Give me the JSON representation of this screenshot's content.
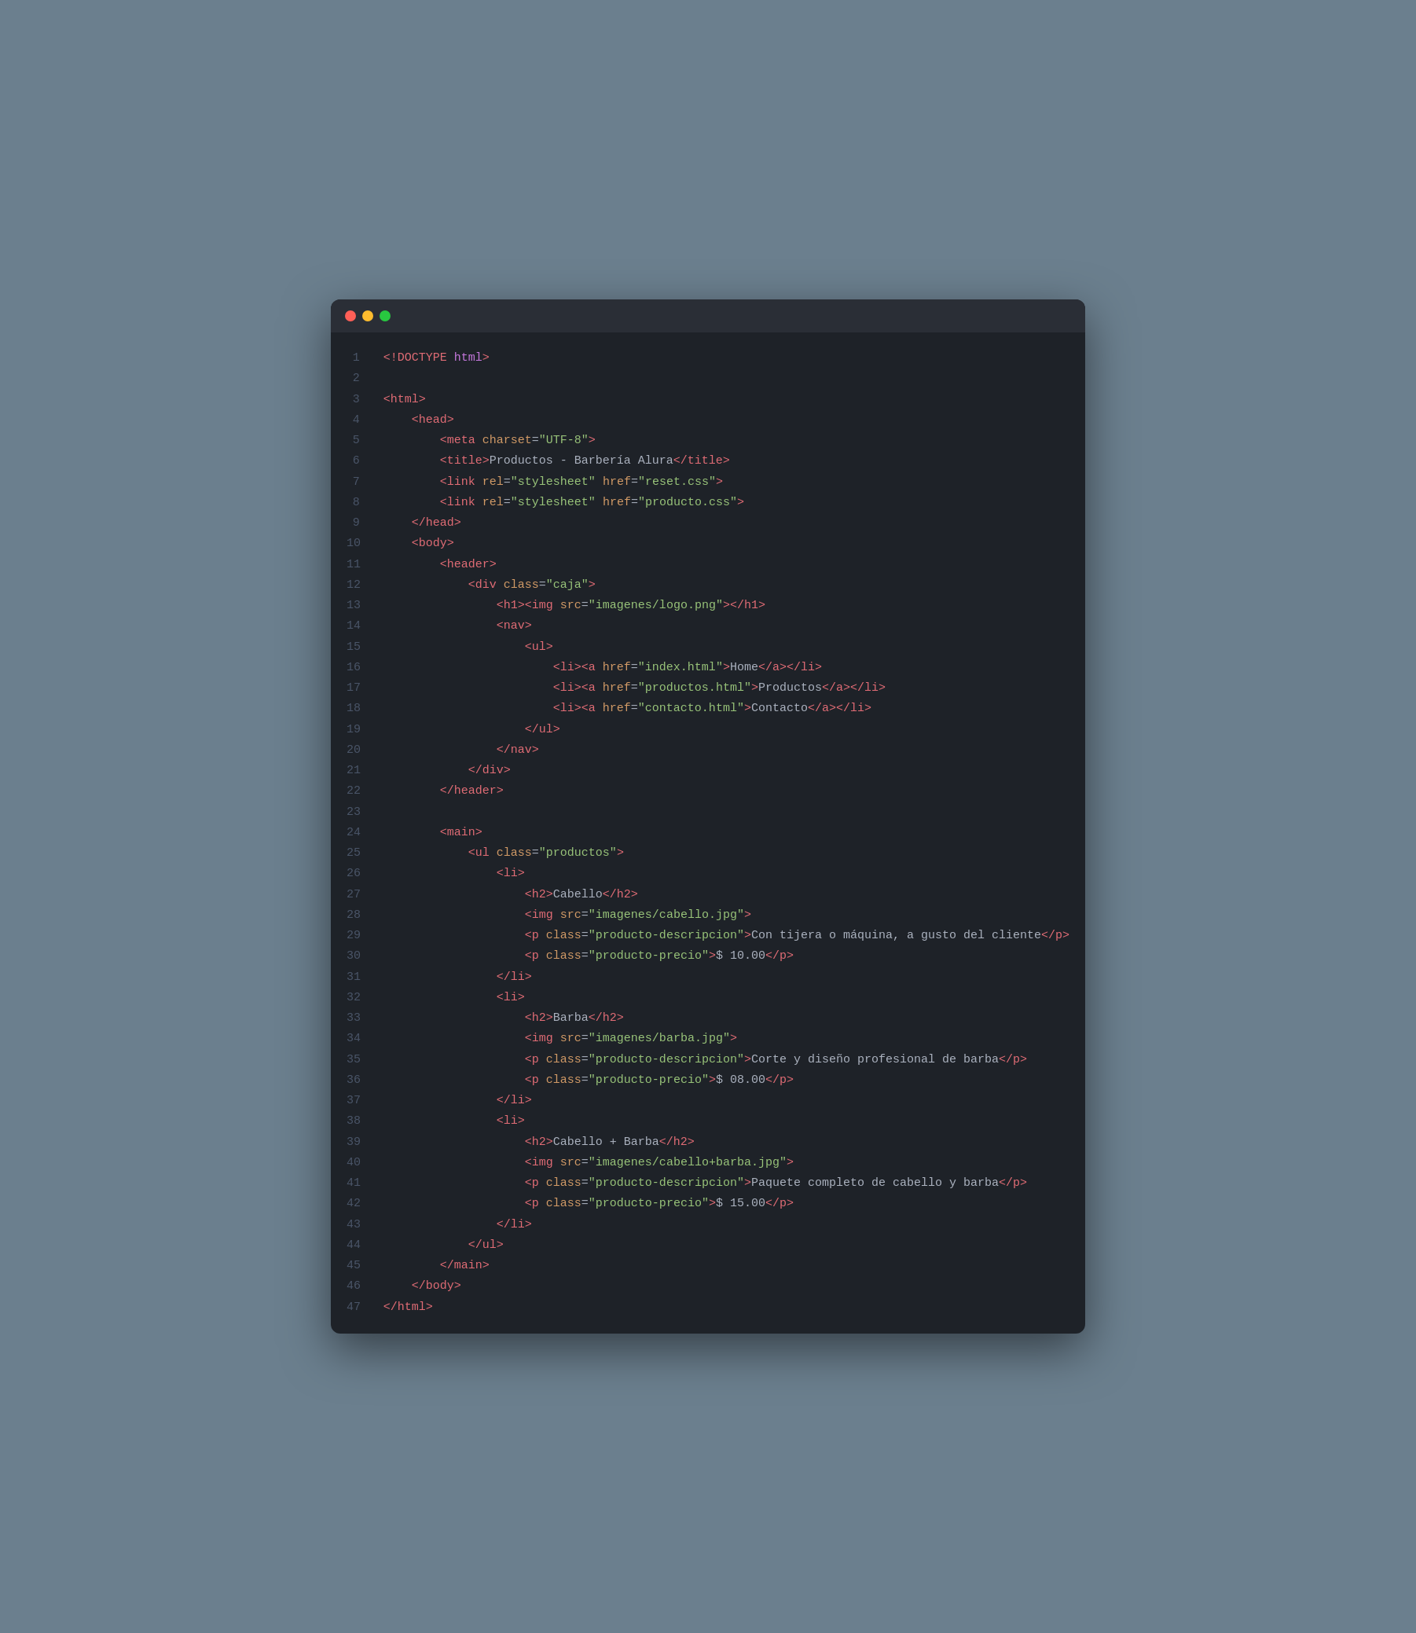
{
  "window": {
    "close_label": "",
    "minimize_label": "",
    "maximize_label": ""
  },
  "lines": [
    {
      "num": 1,
      "tokens": [
        {
          "t": "<!DOCTYPE ",
          "c": "c-tag"
        },
        {
          "t": "html",
          "c": "c-keyword"
        },
        {
          "t": ">",
          "c": "c-tag"
        }
      ]
    },
    {
      "num": 2,
      "tokens": []
    },
    {
      "num": 3,
      "tokens": [
        {
          "t": "<html>",
          "c": "c-tag"
        }
      ]
    },
    {
      "num": 4,
      "tokens": [
        {
          "t": "    <head>",
          "c": "c-tag"
        }
      ]
    },
    {
      "num": 5,
      "tokens": [
        {
          "t": "        <meta ",
          "c": "c-tag"
        },
        {
          "t": "charset",
          "c": "c-attr"
        },
        {
          "t": "=",
          "c": "c-white"
        },
        {
          "t": "\"UTF-8\"",
          "c": "c-string"
        },
        {
          "t": ">",
          "c": "c-tag"
        }
      ]
    },
    {
      "num": 6,
      "tokens": [
        {
          "t": "        <title>",
          "c": "c-tag"
        },
        {
          "t": "Productos - Barbería Alura",
          "c": "c-text"
        },
        {
          "t": "</title>",
          "c": "c-tag"
        }
      ]
    },
    {
      "num": 7,
      "tokens": [
        {
          "t": "        <link ",
          "c": "c-tag"
        },
        {
          "t": "rel",
          "c": "c-attr"
        },
        {
          "t": "=",
          "c": "c-white"
        },
        {
          "t": "\"stylesheet\"",
          "c": "c-string"
        },
        {
          "t": " ",
          "c": "c-white"
        },
        {
          "t": "href",
          "c": "c-attr"
        },
        {
          "t": "=",
          "c": "c-white"
        },
        {
          "t": "\"reset.css\"",
          "c": "c-string"
        },
        {
          "t": ">",
          "c": "c-tag"
        }
      ]
    },
    {
      "num": 8,
      "tokens": [
        {
          "t": "        <link ",
          "c": "c-tag"
        },
        {
          "t": "rel",
          "c": "c-attr"
        },
        {
          "t": "=",
          "c": "c-white"
        },
        {
          "t": "\"stylesheet\"",
          "c": "c-string"
        },
        {
          "t": " ",
          "c": "c-white"
        },
        {
          "t": "href",
          "c": "c-attr"
        },
        {
          "t": "=",
          "c": "c-white"
        },
        {
          "t": "\"producto.css\"",
          "c": "c-string"
        },
        {
          "t": ">",
          "c": "c-tag"
        }
      ]
    },
    {
      "num": 9,
      "tokens": [
        {
          "t": "    </head>",
          "c": "c-tag"
        }
      ]
    },
    {
      "num": 10,
      "tokens": [
        {
          "t": "    <body>",
          "c": "c-tag"
        }
      ]
    },
    {
      "num": 11,
      "tokens": [
        {
          "t": "        <header>",
          "c": "c-tag"
        }
      ]
    },
    {
      "num": 12,
      "tokens": [
        {
          "t": "            <div ",
          "c": "c-tag"
        },
        {
          "t": "class",
          "c": "c-attr"
        },
        {
          "t": "=",
          "c": "c-white"
        },
        {
          "t": "\"caja\"",
          "c": "c-string"
        },
        {
          "t": ">",
          "c": "c-tag"
        }
      ]
    },
    {
      "num": 13,
      "tokens": [
        {
          "t": "                <h1><img ",
          "c": "c-tag"
        },
        {
          "t": "src",
          "c": "c-attr"
        },
        {
          "t": "=",
          "c": "c-white"
        },
        {
          "t": "\"imagenes/logo.png\"",
          "c": "c-string"
        },
        {
          "t": "></h1>",
          "c": "c-tag"
        }
      ]
    },
    {
      "num": 14,
      "tokens": [
        {
          "t": "                <nav>",
          "c": "c-tag"
        }
      ]
    },
    {
      "num": 15,
      "tokens": [
        {
          "t": "                    <ul>",
          "c": "c-tag"
        }
      ]
    },
    {
      "num": 16,
      "tokens": [
        {
          "t": "                        <li><a ",
          "c": "c-tag"
        },
        {
          "t": "href",
          "c": "c-attr"
        },
        {
          "t": "=",
          "c": "c-white"
        },
        {
          "t": "\"index.html\"",
          "c": "c-string"
        },
        {
          "t": ">",
          "c": "c-tag"
        },
        {
          "t": "Home",
          "c": "c-text"
        },
        {
          "t": "</a></li>",
          "c": "c-tag"
        }
      ]
    },
    {
      "num": 17,
      "tokens": [
        {
          "t": "                        <li><a ",
          "c": "c-tag"
        },
        {
          "t": "href",
          "c": "c-attr"
        },
        {
          "t": "=",
          "c": "c-white"
        },
        {
          "t": "\"productos.html\"",
          "c": "c-string"
        },
        {
          "t": ">",
          "c": "c-tag"
        },
        {
          "t": "Productos",
          "c": "c-text"
        },
        {
          "t": "</a></li>",
          "c": "c-tag"
        }
      ]
    },
    {
      "num": 18,
      "tokens": [
        {
          "t": "                        <li><a ",
          "c": "c-tag"
        },
        {
          "t": "href",
          "c": "c-attr"
        },
        {
          "t": "=",
          "c": "c-white"
        },
        {
          "t": "\"contacto.html\"",
          "c": "c-string"
        },
        {
          "t": ">",
          "c": "c-tag"
        },
        {
          "t": "Contacto",
          "c": "c-text"
        },
        {
          "t": "</a></li>",
          "c": "c-tag"
        }
      ]
    },
    {
      "num": 19,
      "tokens": [
        {
          "t": "                    </ul>",
          "c": "c-tag"
        }
      ]
    },
    {
      "num": 20,
      "tokens": [
        {
          "t": "                </nav>",
          "c": "c-tag"
        }
      ]
    },
    {
      "num": 21,
      "tokens": [
        {
          "t": "            </div>",
          "c": "c-tag"
        }
      ]
    },
    {
      "num": 22,
      "tokens": [
        {
          "t": "        </header>",
          "c": "c-tag"
        }
      ]
    },
    {
      "num": 23,
      "tokens": []
    },
    {
      "num": 24,
      "tokens": [
        {
          "t": "        <main>",
          "c": "c-tag"
        }
      ]
    },
    {
      "num": 25,
      "tokens": [
        {
          "t": "            <ul ",
          "c": "c-tag"
        },
        {
          "t": "class",
          "c": "c-attr"
        },
        {
          "t": "=",
          "c": "c-white"
        },
        {
          "t": "\"productos\"",
          "c": "c-string"
        },
        {
          "t": ">",
          "c": "c-tag"
        }
      ]
    },
    {
      "num": 26,
      "tokens": [
        {
          "t": "                <li>",
          "c": "c-tag"
        }
      ]
    },
    {
      "num": 27,
      "tokens": [
        {
          "t": "                    <h2>",
          "c": "c-tag"
        },
        {
          "t": "Cabello",
          "c": "c-text"
        },
        {
          "t": "</h2>",
          "c": "c-tag"
        }
      ]
    },
    {
      "num": 28,
      "tokens": [
        {
          "t": "                    <img ",
          "c": "c-tag"
        },
        {
          "t": "src",
          "c": "c-attr"
        },
        {
          "t": "=",
          "c": "c-white"
        },
        {
          "t": "\"imagenes/cabello.jpg\"",
          "c": "c-string"
        },
        {
          "t": ">",
          "c": "c-tag"
        }
      ]
    },
    {
      "num": 29,
      "tokens": [
        {
          "t": "                    <p ",
          "c": "c-tag"
        },
        {
          "t": "class",
          "c": "c-attr"
        },
        {
          "t": "=",
          "c": "c-white"
        },
        {
          "t": "\"producto-descripcion\"",
          "c": "c-string"
        },
        {
          "t": ">",
          "c": "c-tag"
        },
        {
          "t": "Con tijera o máquina, a gusto del cliente",
          "c": "c-text"
        },
        {
          "t": "</p>",
          "c": "c-tag"
        }
      ]
    },
    {
      "num": 30,
      "tokens": [
        {
          "t": "                    <p ",
          "c": "c-tag"
        },
        {
          "t": "class",
          "c": "c-attr"
        },
        {
          "t": "=",
          "c": "c-white"
        },
        {
          "t": "\"producto-precio\"",
          "c": "c-string"
        },
        {
          "t": ">",
          "c": "c-tag"
        },
        {
          "t": "$ 10.00",
          "c": "c-text"
        },
        {
          "t": "</p>",
          "c": "c-tag"
        }
      ]
    },
    {
      "num": 31,
      "tokens": [
        {
          "t": "                </li>",
          "c": "c-tag"
        }
      ]
    },
    {
      "num": 32,
      "tokens": [
        {
          "t": "                <li>",
          "c": "c-tag"
        }
      ]
    },
    {
      "num": 33,
      "tokens": [
        {
          "t": "                    <h2>",
          "c": "c-tag"
        },
        {
          "t": "Barba",
          "c": "c-text"
        },
        {
          "t": "</h2>",
          "c": "c-tag"
        }
      ]
    },
    {
      "num": 34,
      "tokens": [
        {
          "t": "                    <img ",
          "c": "c-tag"
        },
        {
          "t": "src",
          "c": "c-attr"
        },
        {
          "t": "=",
          "c": "c-white"
        },
        {
          "t": "\"imagenes/barba.jpg\"",
          "c": "c-string"
        },
        {
          "t": ">",
          "c": "c-tag"
        }
      ]
    },
    {
      "num": 35,
      "tokens": [
        {
          "t": "                    <p ",
          "c": "c-tag"
        },
        {
          "t": "class",
          "c": "c-attr"
        },
        {
          "t": "=",
          "c": "c-white"
        },
        {
          "t": "\"producto-descripcion\"",
          "c": "c-string"
        },
        {
          "t": ">",
          "c": "c-tag"
        },
        {
          "t": "Corte y diseño profesional de barba",
          "c": "c-text"
        },
        {
          "t": "</p>",
          "c": "c-tag"
        }
      ]
    },
    {
      "num": 36,
      "tokens": [
        {
          "t": "                    <p ",
          "c": "c-tag"
        },
        {
          "t": "class",
          "c": "c-attr"
        },
        {
          "t": "=",
          "c": "c-white"
        },
        {
          "t": "\"producto-precio\"",
          "c": "c-string"
        },
        {
          "t": ">",
          "c": "c-tag"
        },
        {
          "t": "$ 08.00",
          "c": "c-text"
        },
        {
          "t": "</p>",
          "c": "c-tag"
        }
      ]
    },
    {
      "num": 37,
      "tokens": [
        {
          "t": "                </li>",
          "c": "c-tag"
        }
      ]
    },
    {
      "num": 38,
      "tokens": [
        {
          "t": "                <li>",
          "c": "c-tag"
        }
      ]
    },
    {
      "num": 39,
      "tokens": [
        {
          "t": "                    <h2>",
          "c": "c-tag"
        },
        {
          "t": "Cabello + Barba",
          "c": "c-text"
        },
        {
          "t": "</h2>",
          "c": "c-tag"
        }
      ]
    },
    {
      "num": 40,
      "tokens": [
        {
          "t": "                    <img ",
          "c": "c-tag"
        },
        {
          "t": "src",
          "c": "c-attr"
        },
        {
          "t": "=",
          "c": "c-white"
        },
        {
          "t": "\"imagenes/cabello+barba.jpg\"",
          "c": "c-string"
        },
        {
          "t": ">",
          "c": "c-tag"
        }
      ]
    },
    {
      "num": 41,
      "tokens": [
        {
          "t": "                    <p ",
          "c": "c-tag"
        },
        {
          "t": "class",
          "c": "c-attr"
        },
        {
          "t": "=",
          "c": "c-white"
        },
        {
          "t": "\"producto-descripcion\"",
          "c": "c-string"
        },
        {
          "t": ">",
          "c": "c-tag"
        },
        {
          "t": "Paquete completo de cabello y barba",
          "c": "c-text"
        },
        {
          "t": "</p>",
          "c": "c-tag"
        }
      ]
    },
    {
      "num": 42,
      "tokens": [
        {
          "t": "                    <p ",
          "c": "c-tag"
        },
        {
          "t": "class",
          "c": "c-attr"
        },
        {
          "t": "=",
          "c": "c-white"
        },
        {
          "t": "\"producto-precio\"",
          "c": "c-string"
        },
        {
          "t": ">",
          "c": "c-tag"
        },
        {
          "t": "$ 15.00",
          "c": "c-text"
        },
        {
          "t": "</p>",
          "c": "c-tag"
        }
      ]
    },
    {
      "num": 43,
      "tokens": [
        {
          "t": "                </li>",
          "c": "c-tag"
        }
      ]
    },
    {
      "num": 44,
      "tokens": [
        {
          "t": "            </ul>",
          "c": "c-tag"
        }
      ]
    },
    {
      "num": 45,
      "tokens": [
        {
          "t": "        </main>",
          "c": "c-tag"
        }
      ]
    },
    {
      "num": 46,
      "tokens": [
        {
          "t": "    </body>",
          "c": "c-tag"
        }
      ]
    },
    {
      "num": 47,
      "tokens": [
        {
          "t": "</html>",
          "c": "c-tag"
        }
      ]
    }
  ]
}
